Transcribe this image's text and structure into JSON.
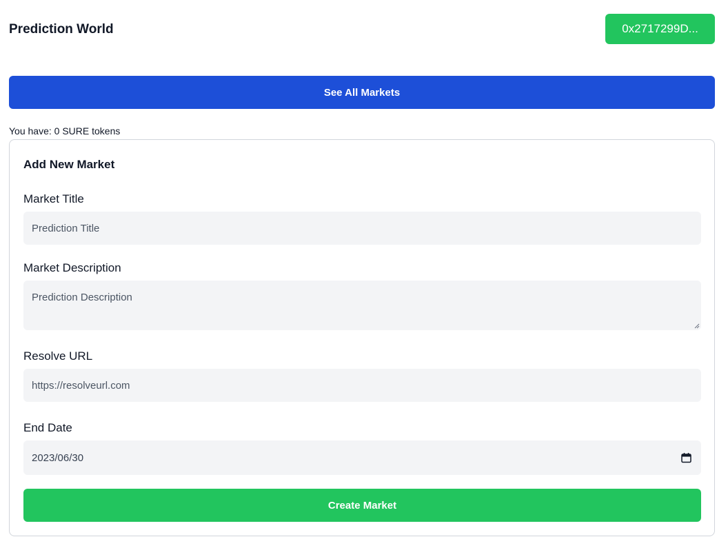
{
  "header": {
    "app_title": "Prediction World",
    "wallet_label": "0x2717299D..."
  },
  "nav": {
    "see_all_label": "See All Markets"
  },
  "balance": {
    "text": "You have: 0 SURE tokens"
  },
  "form": {
    "title": "Add New Market",
    "market_title": {
      "label": "Market Title",
      "placeholder": "Prediction Title",
      "value": ""
    },
    "market_description": {
      "label": "Market Description",
      "placeholder": "Prediction Description",
      "value": ""
    },
    "resolve_url": {
      "label": "Resolve URL",
      "placeholder": "https://resolveurl.com",
      "value": ""
    },
    "end_date": {
      "label": "End Date",
      "value": "2023/06/30"
    },
    "submit_label": "Create Market"
  },
  "colors": {
    "primary_blue": "#1d4fd8",
    "success_green": "#22c55e",
    "input_bg": "#f3f4f6"
  },
  "icons": [
    "calendar-icon",
    "resize-handle-icon"
  ]
}
